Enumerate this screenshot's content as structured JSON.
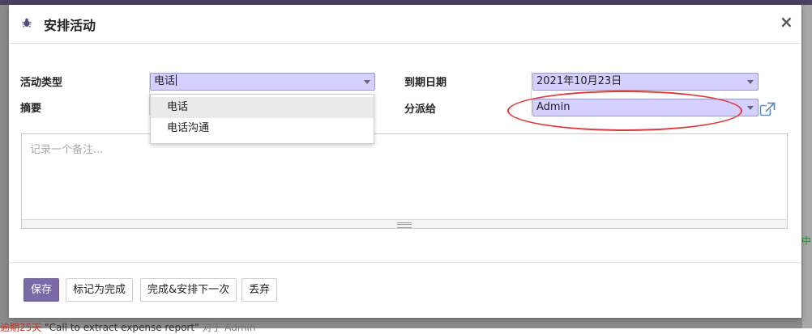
{
  "dialog": {
    "title": "安排活动",
    "close_symbol": "×"
  },
  "form": {
    "activity_type": {
      "label": "活动类型",
      "value": "电话"
    },
    "summary": {
      "label": "摘要"
    },
    "due_date": {
      "label": "到期日期",
      "value": "2021年10月23日"
    },
    "assigned_to": {
      "label": "分派给",
      "value": "Admin"
    },
    "note": {
      "placeholder": "记录一个备注..."
    }
  },
  "dropdown": {
    "options": [
      "电话",
      "电话沟通"
    ],
    "highlighted_index": 0
  },
  "footer": {
    "save": "保存",
    "mark_done": "标记为完成",
    "done_schedule_next": "完成&安排下一次",
    "discard": "丢弃"
  },
  "background": {
    "right_fragment": "中",
    "bottom_fragment_red": "逾期25天",
    "bottom_fragment_text": "\"Call to extract expense report\"",
    "bottom_fragment_muted": "对于 Admin"
  },
  "colors": {
    "field_highlight": "#d4d0ff",
    "primary_button": "#7c6aa8",
    "annotation_ellipse": "#e03a3a"
  },
  "icons": {
    "header": "bug-icon",
    "external_link": "external-link-icon",
    "caret": "caret-down-icon"
  }
}
